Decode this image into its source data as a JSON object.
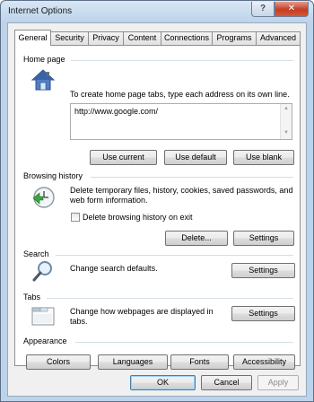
{
  "window": {
    "title": "Internet Options",
    "help_glyph": "?",
    "close_glyph": "✕"
  },
  "tabs": [
    {
      "label": "General"
    },
    {
      "label": "Security"
    },
    {
      "label": "Privacy"
    },
    {
      "label": "Content"
    },
    {
      "label": "Connections"
    },
    {
      "label": "Programs"
    },
    {
      "label": "Advanced"
    }
  ],
  "home_page": {
    "heading": "Home page",
    "description": "To create home page tabs, type each address on its own line.",
    "url": "http://www.google.com/",
    "buttons": {
      "use_current": "Use current",
      "use_default": "Use default",
      "use_blank": "Use blank"
    }
  },
  "browsing_history": {
    "heading": "Browsing history",
    "description": "Delete temporary files, history, cookies, saved passwords, and web form information.",
    "checkbox_label": "Delete browsing history on exit",
    "checkbox_checked": false,
    "buttons": {
      "delete": "Delete...",
      "settings": "Settings"
    }
  },
  "search": {
    "heading": "Search",
    "description": "Change search defaults.",
    "settings": "Settings"
  },
  "tabs_section": {
    "heading": "Tabs",
    "description": "Change how webpages are displayed in tabs.",
    "settings": "Settings"
  },
  "appearance": {
    "heading": "Appearance",
    "buttons": {
      "colors": "Colors",
      "languages": "Languages",
      "fonts": "Fonts",
      "accessibility": "Accessibility"
    }
  },
  "footer": {
    "ok": "OK",
    "cancel": "Cancel",
    "apply": "Apply"
  },
  "icons": {
    "home": "house-icon",
    "history": "history-clock-icon",
    "search": "magnifier-icon",
    "tabs": "tabs-window-icon"
  }
}
